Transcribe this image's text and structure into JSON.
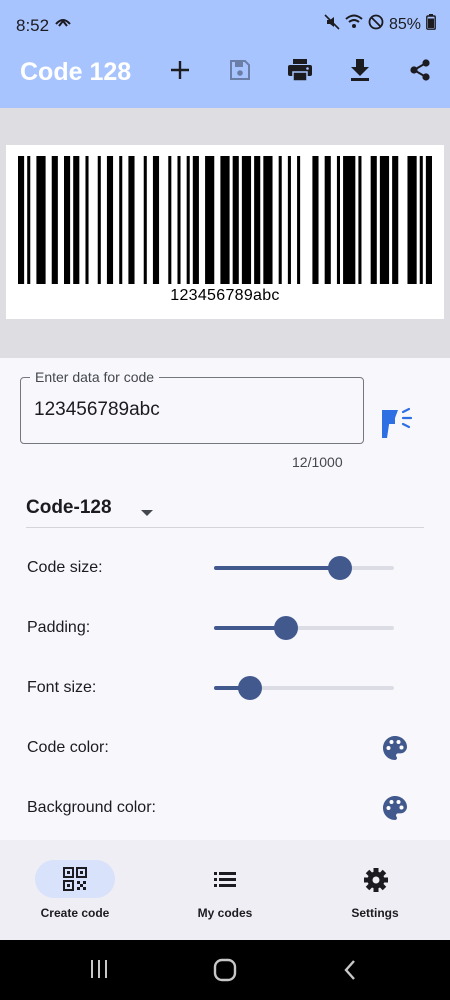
{
  "status": {
    "time": "8:52",
    "battery": "85%"
  },
  "app_bar": {
    "title": "Code 128",
    "actions": [
      "add-icon",
      "save-icon",
      "print-icon",
      "download-icon",
      "share-icon"
    ]
  },
  "preview": {
    "barcode_text": "123456789abc"
  },
  "form": {
    "data_label": "Enter data for code",
    "data_value": "123456789abc",
    "counter": "12/1000",
    "code_type": "Code-128",
    "code_size_label": "Code size:",
    "code_size_value": 0.7,
    "padding_label": "Padding:",
    "padding_value": 0.4,
    "font_size_label": "Font size:",
    "font_size_value": 0.2,
    "code_color_label": "Code color:",
    "background_color_label": "Background color:"
  },
  "nav": {
    "items": [
      {
        "label": "Create code",
        "icon": "qr-code-icon",
        "active": true
      },
      {
        "label": "My codes",
        "icon": "list-icon",
        "active": false
      },
      {
        "label": "Settings",
        "icon": "settings-icon",
        "active": false
      }
    ]
  },
  "colors": {
    "app_bar": "#a8c4ff",
    "accent": "#42598e",
    "scan_icon": "#2f6fe4"
  }
}
